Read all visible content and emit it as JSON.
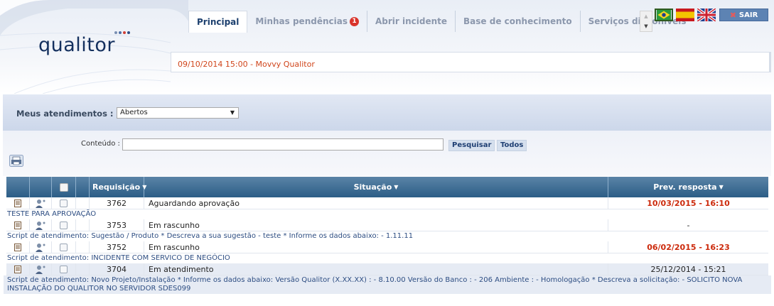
{
  "header": {
    "logo_text": "qualitor",
    "nav_tabs": [
      {
        "label": "Principal",
        "active": true
      },
      {
        "label": "Minhas pendências",
        "badge": "1"
      },
      {
        "label": "Abrir incidente"
      },
      {
        "label": "Base de conhecimento"
      },
      {
        "label": "Serviços disponíveis"
      }
    ],
    "sair_label": "SAIR",
    "message": "09/10/2014 15:00 - Movvy Qualitor"
  },
  "filter": {
    "label": "Meus atendimentos :",
    "selected": "Abertos",
    "conteudo_label": "Conteúdo :",
    "conteudo_value": "",
    "pesquisar_label": "Pesquisar",
    "todos_label": "Todos"
  },
  "table": {
    "columns": [
      "Requisição",
      "Situação",
      "Prev. resposta"
    ],
    "rows": [
      {
        "req": "3762",
        "situacao": "Aguardando aprovação",
        "prev": "10/03/2015 - 16:10",
        "prev_late": true,
        "desc": "TESTE PARA APROVAÇÃO"
      },
      {
        "req": "3753",
        "situacao": "Em rascunho",
        "prev": "-",
        "prev_late": false,
        "desc": "Script de atendimento: Sugestão / Produto * Descreva a sua sugestão - teste * Informe os dados abaixo: - 1.11.11"
      },
      {
        "req": "3752",
        "situacao": "Em rascunho",
        "prev": "06/02/2015 - 16:23",
        "prev_late": true,
        "desc": "Script de atendimento: INCIDENTE COM SERVICO DE NEGÓCIO"
      },
      {
        "req": "3704",
        "situacao": "Em atendimento",
        "prev": "25/12/2014 - 15:21",
        "prev_late": false,
        "desc": "Script de atendimento: Novo Projeto/Instalação * Informe os dados abaixo: Versão Qualitor (X.XX.XX) : - 8.10.00 Versão do Banco : - 206 Ambiente : - Homologação * Descreva a solicitação: - SOLICITO NOVA INSTALAÇÃO DO QUALITOR NO SERVIDOR SDES099"
      }
    ]
  }
}
